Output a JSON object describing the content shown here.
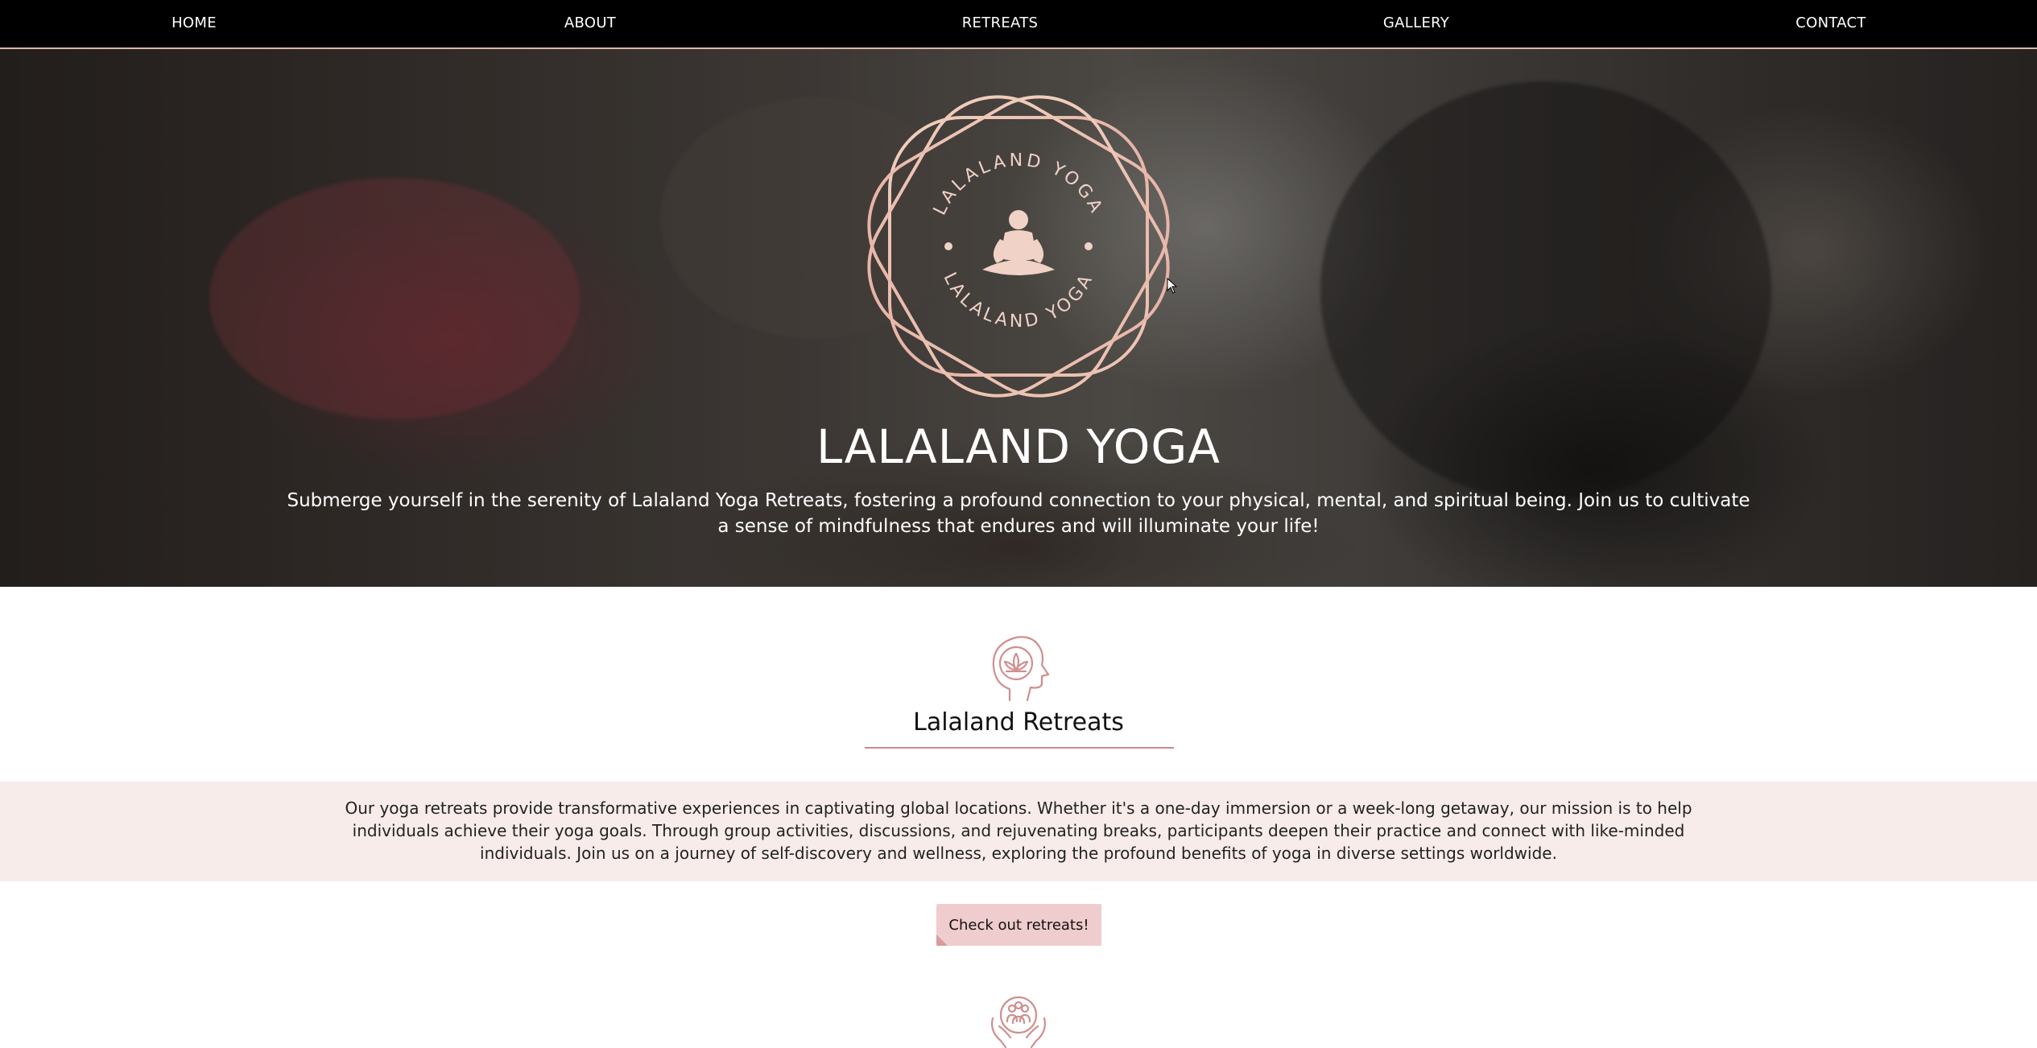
{
  "nav": {
    "items": [
      {
        "label": "HOME"
      },
      {
        "label": "ABOUT"
      },
      {
        "label": "RETREATS"
      },
      {
        "label": "GALLERY"
      },
      {
        "label": "CONTACT"
      }
    ]
  },
  "hero": {
    "logo_text": "LALALAND YOGA",
    "title": "LALALAND YOGA",
    "subtitle": "Submerge yourself in the serenity of Lalaland Yoga Retreats, fostering a profound connection to your physical, mental, and spiritual being. Join us to cultivate a sense of mindfulness that endures and will illuminate your life!"
  },
  "retreats": {
    "icon": "lotus-head-icon",
    "title": "Lalaland Retreats",
    "description": "Our yoga retreats provide transformative experiences in captivating global locations. Whether it's a one-day immersion or a week-long getaway, our mission is to help individuals achieve their yoga goals. Through group activities, discussions, and rejuvenating breaks, participants deepen their practice and connect with like-minded individuals. Join us on a journey of self-discovery and wellness, exploring the profound benefits of yoga in diverse settings worldwide.",
    "cta_label": "Check out retreats!"
  },
  "next_section": {
    "icon": "hands-community-icon"
  },
  "colors": {
    "nav_bg": "#000000",
    "accent_rose": "#c98a8a",
    "band_bg": "#f7ecea",
    "button_bg": "#efcccd"
  }
}
